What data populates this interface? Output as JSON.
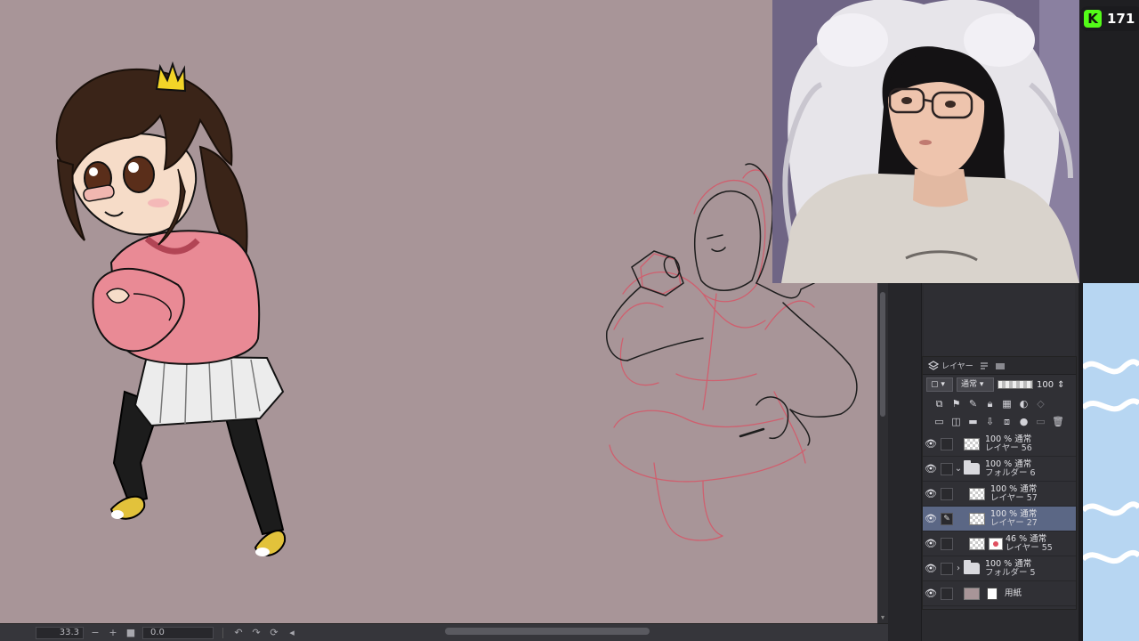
{
  "app": {
    "canvas_background": "#a89598",
    "zoom_value": "33.3",
    "angle_value": "0.0"
  },
  "stream_badge": {
    "logo_letter": "K",
    "viewer_count": "171",
    "accent": "#53fc18"
  },
  "layer_panel": {
    "tabs": [
      {
        "icon": "layer-icon",
        "label": "レイヤー"
      },
      {
        "icon": "list-icon",
        "label": ""
      },
      {
        "icon": "folder-tab-icon",
        "label": ""
      }
    ],
    "blend_mode": "通常",
    "opacity": "100",
    "layers": [
      {
        "line1": "100 % 通常",
        "line2": "レイヤー 56",
        "kind": "layer",
        "active": false
      },
      {
        "line1": "100 % 通常",
        "line2": "フォルダー 6",
        "kind": "folder-open",
        "active": false
      },
      {
        "line1": "100 % 通常",
        "line2": "レイヤー 57",
        "kind": "layer",
        "active": false
      },
      {
        "line1": "100 % 通常",
        "line2": "レイヤー 27",
        "kind": "layer",
        "active": true
      },
      {
        "line1": "46 % 通常",
        "line2": "レイヤー 55",
        "kind": "layer-mask",
        "active": false
      },
      {
        "line1": "100 % 通常",
        "line2": "フォルダー 5",
        "kind": "folder-closed",
        "active": false
      },
      {
        "line1": "用紙",
        "line2": "",
        "kind": "paper",
        "active": false
      }
    ]
  }
}
